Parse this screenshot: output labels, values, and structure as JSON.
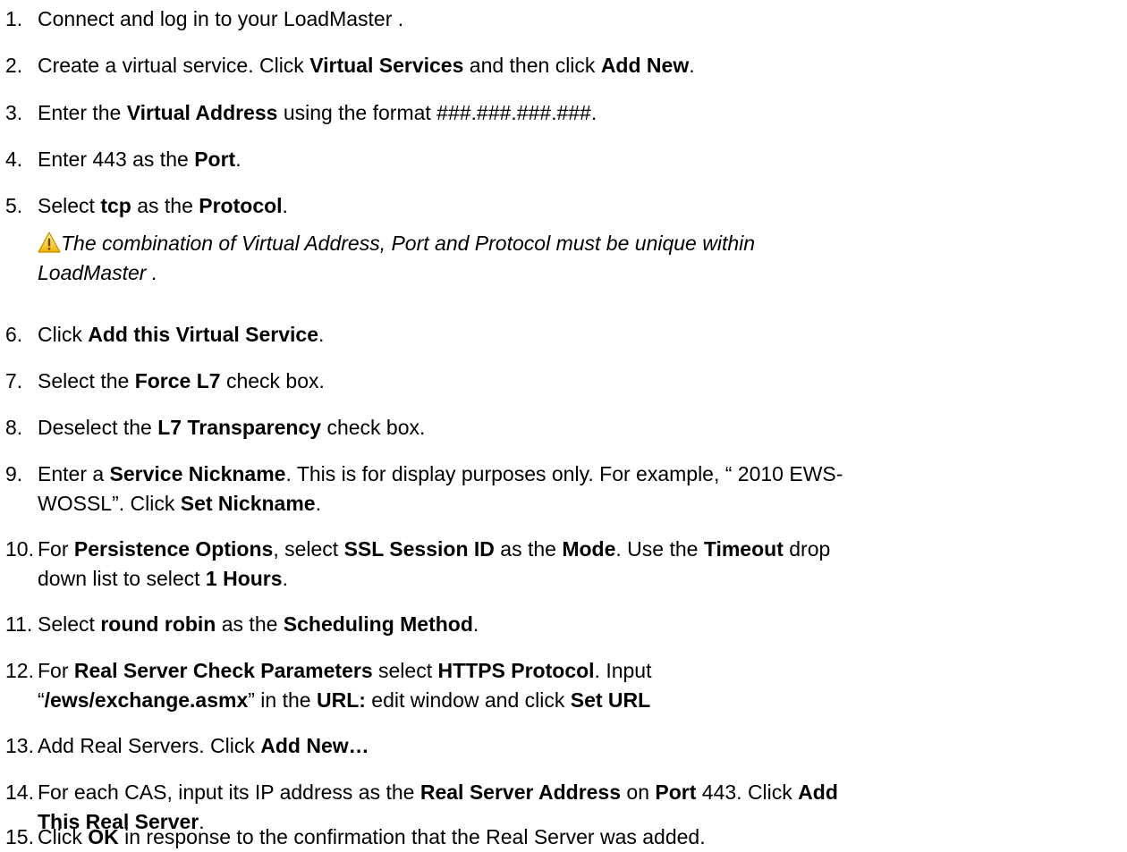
{
  "steps": [
    {
      "n": "1.",
      "parts": [
        [
          "t",
          "Connect and log in to your LoadMaster  ."
        ]
      ]
    },
    {
      "n": "2.",
      "parts": [
        [
          "t",
          "Create a virtual service. Click "
        ],
        [
          "b",
          "Virtual Services"
        ],
        [
          "t",
          " and then click "
        ],
        [
          "b",
          "Add New"
        ],
        [
          "t",
          "."
        ]
      ]
    },
    {
      "n": "3.",
      "parts": [
        [
          "t",
          "Enter the "
        ],
        [
          "b",
          "Virtual Address"
        ],
        [
          "t",
          " using the format ###.###.###.###."
        ]
      ]
    },
    {
      "n": "4.",
      "parts": [
        [
          "t",
          "Enter 443 as the "
        ],
        [
          "b",
          "Port"
        ],
        [
          "t",
          "."
        ]
      ]
    },
    {
      "n": "5.",
      "parts": [
        [
          "t",
          "Select "
        ],
        [
          "b",
          "tcp"
        ],
        [
          "t",
          " as the "
        ],
        [
          "b",
          "Protocol"
        ],
        [
          "t",
          "."
        ]
      ]
    },
    {
      "n": "6.",
      "parts": [
        [
          "t",
          "Click "
        ],
        [
          "b",
          "Add this Virtual Service"
        ],
        [
          "t",
          "."
        ]
      ]
    },
    {
      "n": "7.",
      "parts": [
        [
          "t",
          "Select the "
        ],
        [
          "b",
          "Force L7"
        ],
        [
          "t",
          " check box."
        ]
      ]
    },
    {
      "n": "8.",
      "parts": [
        [
          "t",
          "Deselect the "
        ],
        [
          "b",
          "L7 Transparency"
        ],
        [
          "t",
          " check box."
        ]
      ]
    },
    {
      "n": "9.",
      "parts": [
        [
          "t",
          "Enter a "
        ],
        [
          "b",
          "Service Nickname"
        ],
        [
          "t",
          ". This is for display purposes only. For example, “ 2010 EWS-"
        ],
        [
          "br",
          ""
        ],
        [
          "t",
          "WOSSL”. Click "
        ],
        [
          "b",
          "Set Nickname"
        ],
        [
          "t",
          "."
        ]
      ]
    },
    {
      "n": "10.",
      "parts": [
        [
          "t",
          "For "
        ],
        [
          "b",
          "Persistence Options"
        ],
        [
          "t",
          ", select "
        ],
        [
          "b",
          "SSL Session ID"
        ],
        [
          "t",
          " as the "
        ],
        [
          "b",
          "Mode"
        ],
        [
          "t",
          ". Use the "
        ],
        [
          "b",
          "Timeout"
        ],
        [
          "t",
          " drop"
        ],
        [
          "br",
          ""
        ],
        [
          "t",
          "down list to select "
        ],
        [
          "b",
          "1 Hours"
        ],
        [
          "t",
          "."
        ]
      ]
    },
    {
      "n": "11.",
      "parts": [
        [
          "t",
          "Select "
        ],
        [
          "b",
          "round robin"
        ],
        [
          "t",
          " as the "
        ],
        [
          "b",
          "Scheduling Method"
        ],
        [
          "t",
          "."
        ]
      ]
    },
    {
      "n": "12.",
      "parts": [
        [
          "t",
          "For "
        ],
        [
          "b",
          "Real Server Check Parameters"
        ],
        [
          "t",
          " select "
        ],
        [
          "b",
          "HTTPS Protocol"
        ],
        [
          "t",
          ". Input"
        ],
        [
          "br",
          ""
        ],
        [
          "t",
          "“"
        ],
        [
          "b",
          "/ews/exchange.asmx"
        ],
        [
          "t",
          "” in the "
        ],
        [
          "b",
          "URL:"
        ],
        [
          "t",
          " edit window and click "
        ],
        [
          "b",
          "Set URL"
        ]
      ]
    },
    {
      "n": "13.",
      "parts": [
        [
          "t",
          "Add Real Servers. Click "
        ],
        [
          "b",
          "Add New…"
        ]
      ]
    },
    {
      "n": "14.",
      "parts": [
        [
          "t",
          "For each CAS, input its IP address as the "
        ],
        [
          "b",
          "Real Server Address"
        ],
        [
          "t",
          " on "
        ],
        [
          "b",
          "Port"
        ],
        [
          "t",
          " 443. Click "
        ],
        [
          "b",
          "Add"
        ],
        [
          "br",
          ""
        ],
        [
          "b",
          "This Real Server"
        ],
        [
          "t",
          "."
        ]
      ]
    },
    {
      "n": "15.",
      "parts": [
        [
          "t",
          "Click "
        ],
        [
          "b",
          "OK"
        ],
        [
          "t",
          " in response to the confirmation that the Real Server was added."
        ]
      ]
    }
  ],
  "note": {
    "line1": "The combination of Virtual Address, Port and Protocol must be unique within",
    "line2": "LoadMaster  .",
    "icon": "warning-icon"
  }
}
